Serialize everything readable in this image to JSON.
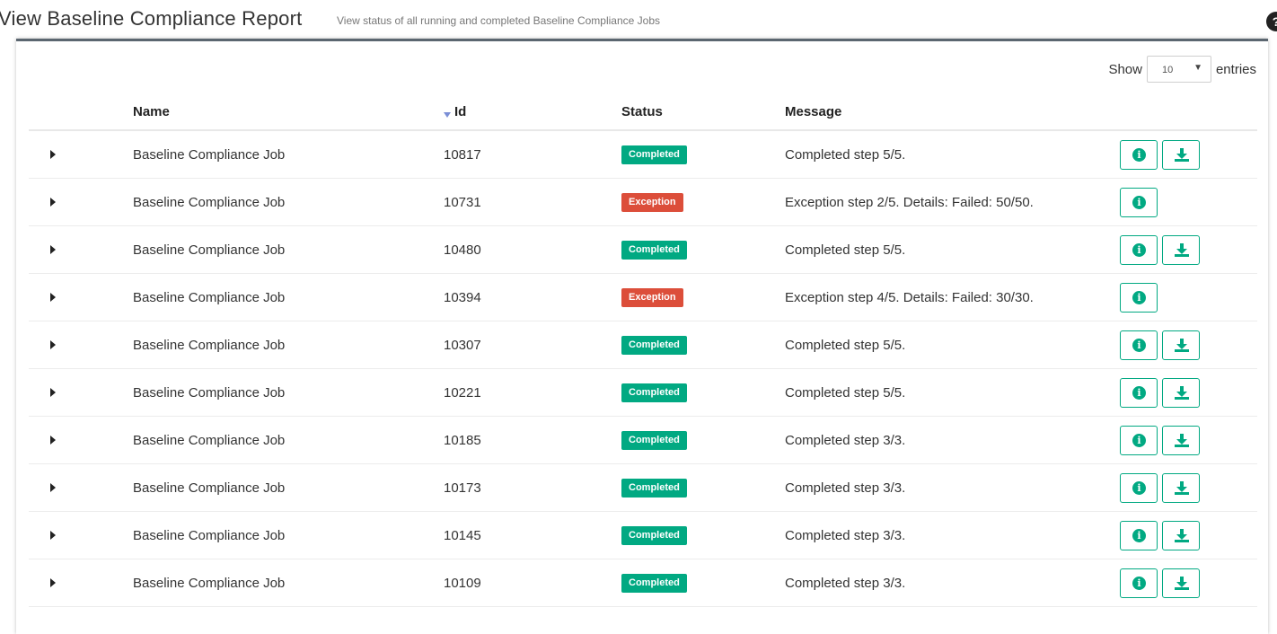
{
  "header": {
    "title": "View Baseline Compliance Report",
    "subtitle": "View status of all running and completed Baseline Compliance Jobs",
    "help_glyph": "?"
  },
  "length_control": {
    "prefix": "Show",
    "value": "10",
    "suffix": "entries"
  },
  "table": {
    "columns": [
      "Name",
      "Id",
      "Status",
      "Message"
    ],
    "rows": [
      {
        "name": "Baseline Compliance Job",
        "id": "10817",
        "status": "Completed",
        "message": "Completed step 5/5.",
        "download": true
      },
      {
        "name": "Baseline Compliance Job",
        "id": "10731",
        "status": "Exception",
        "message": "Exception step 2/5. Details: Failed: 50/50.",
        "download": false
      },
      {
        "name": "Baseline Compliance Job",
        "id": "10480",
        "status": "Completed",
        "message": "Completed step 5/5.",
        "download": true
      },
      {
        "name": "Baseline Compliance Job",
        "id": "10394",
        "status": "Exception",
        "message": "Exception step 4/5. Details: Failed: 30/30.",
        "download": false
      },
      {
        "name": "Baseline Compliance Job",
        "id": "10307",
        "status": "Completed",
        "message": "Completed step 5/5.",
        "download": true
      },
      {
        "name": "Baseline Compliance Job",
        "id": "10221",
        "status": "Completed",
        "message": "Completed step 5/5.",
        "download": true
      },
      {
        "name": "Baseline Compliance Job",
        "id": "10185",
        "status": "Completed",
        "message": "Completed step 3/3.",
        "download": true
      },
      {
        "name": "Baseline Compliance Job",
        "id": "10173",
        "status": "Completed",
        "message": "Completed step 3/3.",
        "download": true
      },
      {
        "name": "Baseline Compliance Job",
        "id": "10145",
        "status": "Completed",
        "message": "Completed step 3/3.",
        "download": true
      },
      {
        "name": "Baseline Compliance Job",
        "id": "10109",
        "status": "Completed",
        "message": "Completed step 3/3.",
        "download": true
      }
    ]
  },
  "icons": {
    "expand": "caret-right-icon",
    "sort": "sort-desc-icon",
    "info": "info-icon",
    "download": "download-icon",
    "help": "help-icon"
  },
  "colors": {
    "success": "#01a982",
    "exception": "#dc4e3a",
    "panel_border": "#5b6670",
    "sort_arrow": "#7b8fd6"
  }
}
